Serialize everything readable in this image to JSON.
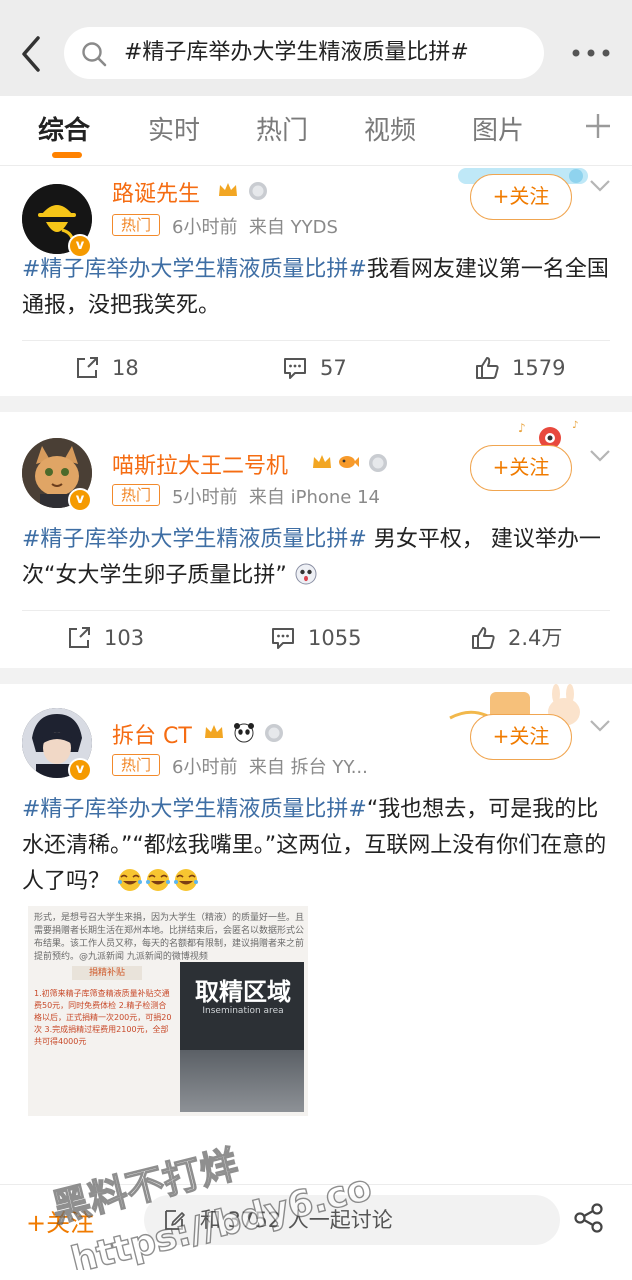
{
  "header": {
    "search_query": "#精子库举办大学生精液质量比拼#"
  },
  "tabs": [
    "综合",
    "实时",
    "热门",
    "视频",
    "图片"
  ],
  "posts": [
    {
      "username": "路诞先生",
      "tag": "热门",
      "time": "6小时前",
      "source": "来自 YYDS",
      "follow": "+关注",
      "hashtag": "#精子库举办大学生精液质量比拼#",
      "text": "我看网友建议第一名全国通报，没把我笑死。",
      "reposts": "18",
      "comments": "57",
      "likes": "1579"
    },
    {
      "username": "喵斯拉大王二号机",
      "tag": "热门",
      "time": "5小时前",
      "source": "来自 iPhone 14",
      "follow": "+关注",
      "hashtag": "#精子库举办大学生精液质量比拼#",
      "text": " 男女平权，  建议举办一次“女大学生卵子质量比拼”",
      "reposts": "103",
      "comments": "1055",
      "likes": "2.4万"
    },
    {
      "username": "拆台 CT",
      "tag": "热门",
      "time": "6小时前",
      "source": "来自 拆台 YY...",
      "follow": "+关注",
      "hashtag": "#精子库举办大学生精液质量比拼#",
      "text": "“我也想去，可是我的比水还清稀。”“都炫我嘴里。”这两位，互联网上没有你们在意的人了吗？",
      "image": {
        "caption": "形式，是想号召大学生来捐，因为大学生（精液）的质量好一些。且需要捐赠者长期生活在郑州本地。比拼结束后，会匿名以数据形式公布结果。该工作人员又称，每天的名额都有限制，建议捐赠者来之前提前预约。@九派新闻 九派新闻的微博视频",
        "subsidy_title": "捐精补贴",
        "subsidy_lines": "1.初筛来精子库筛查精液质量补贴交通费50元，同时免费体检  2.精子检测合格以后，正式捐精一次200元，可捐20次  3.完成捐精过程费用2100元，全部共可得4000元",
        "sign_text": "取精区域",
        "sign_sub": "Insemination area"
      }
    }
  ],
  "bottom": {
    "follow": "+关注",
    "discuss": "和 3752 人一起讨论"
  },
  "watermark": {
    "line1": "黑料不打烊",
    "line2": "https://bdy6.co"
  },
  "colors": {
    "accent": "#ff8200",
    "username": "#f56c12",
    "hashtag": "#3e6ea4"
  }
}
